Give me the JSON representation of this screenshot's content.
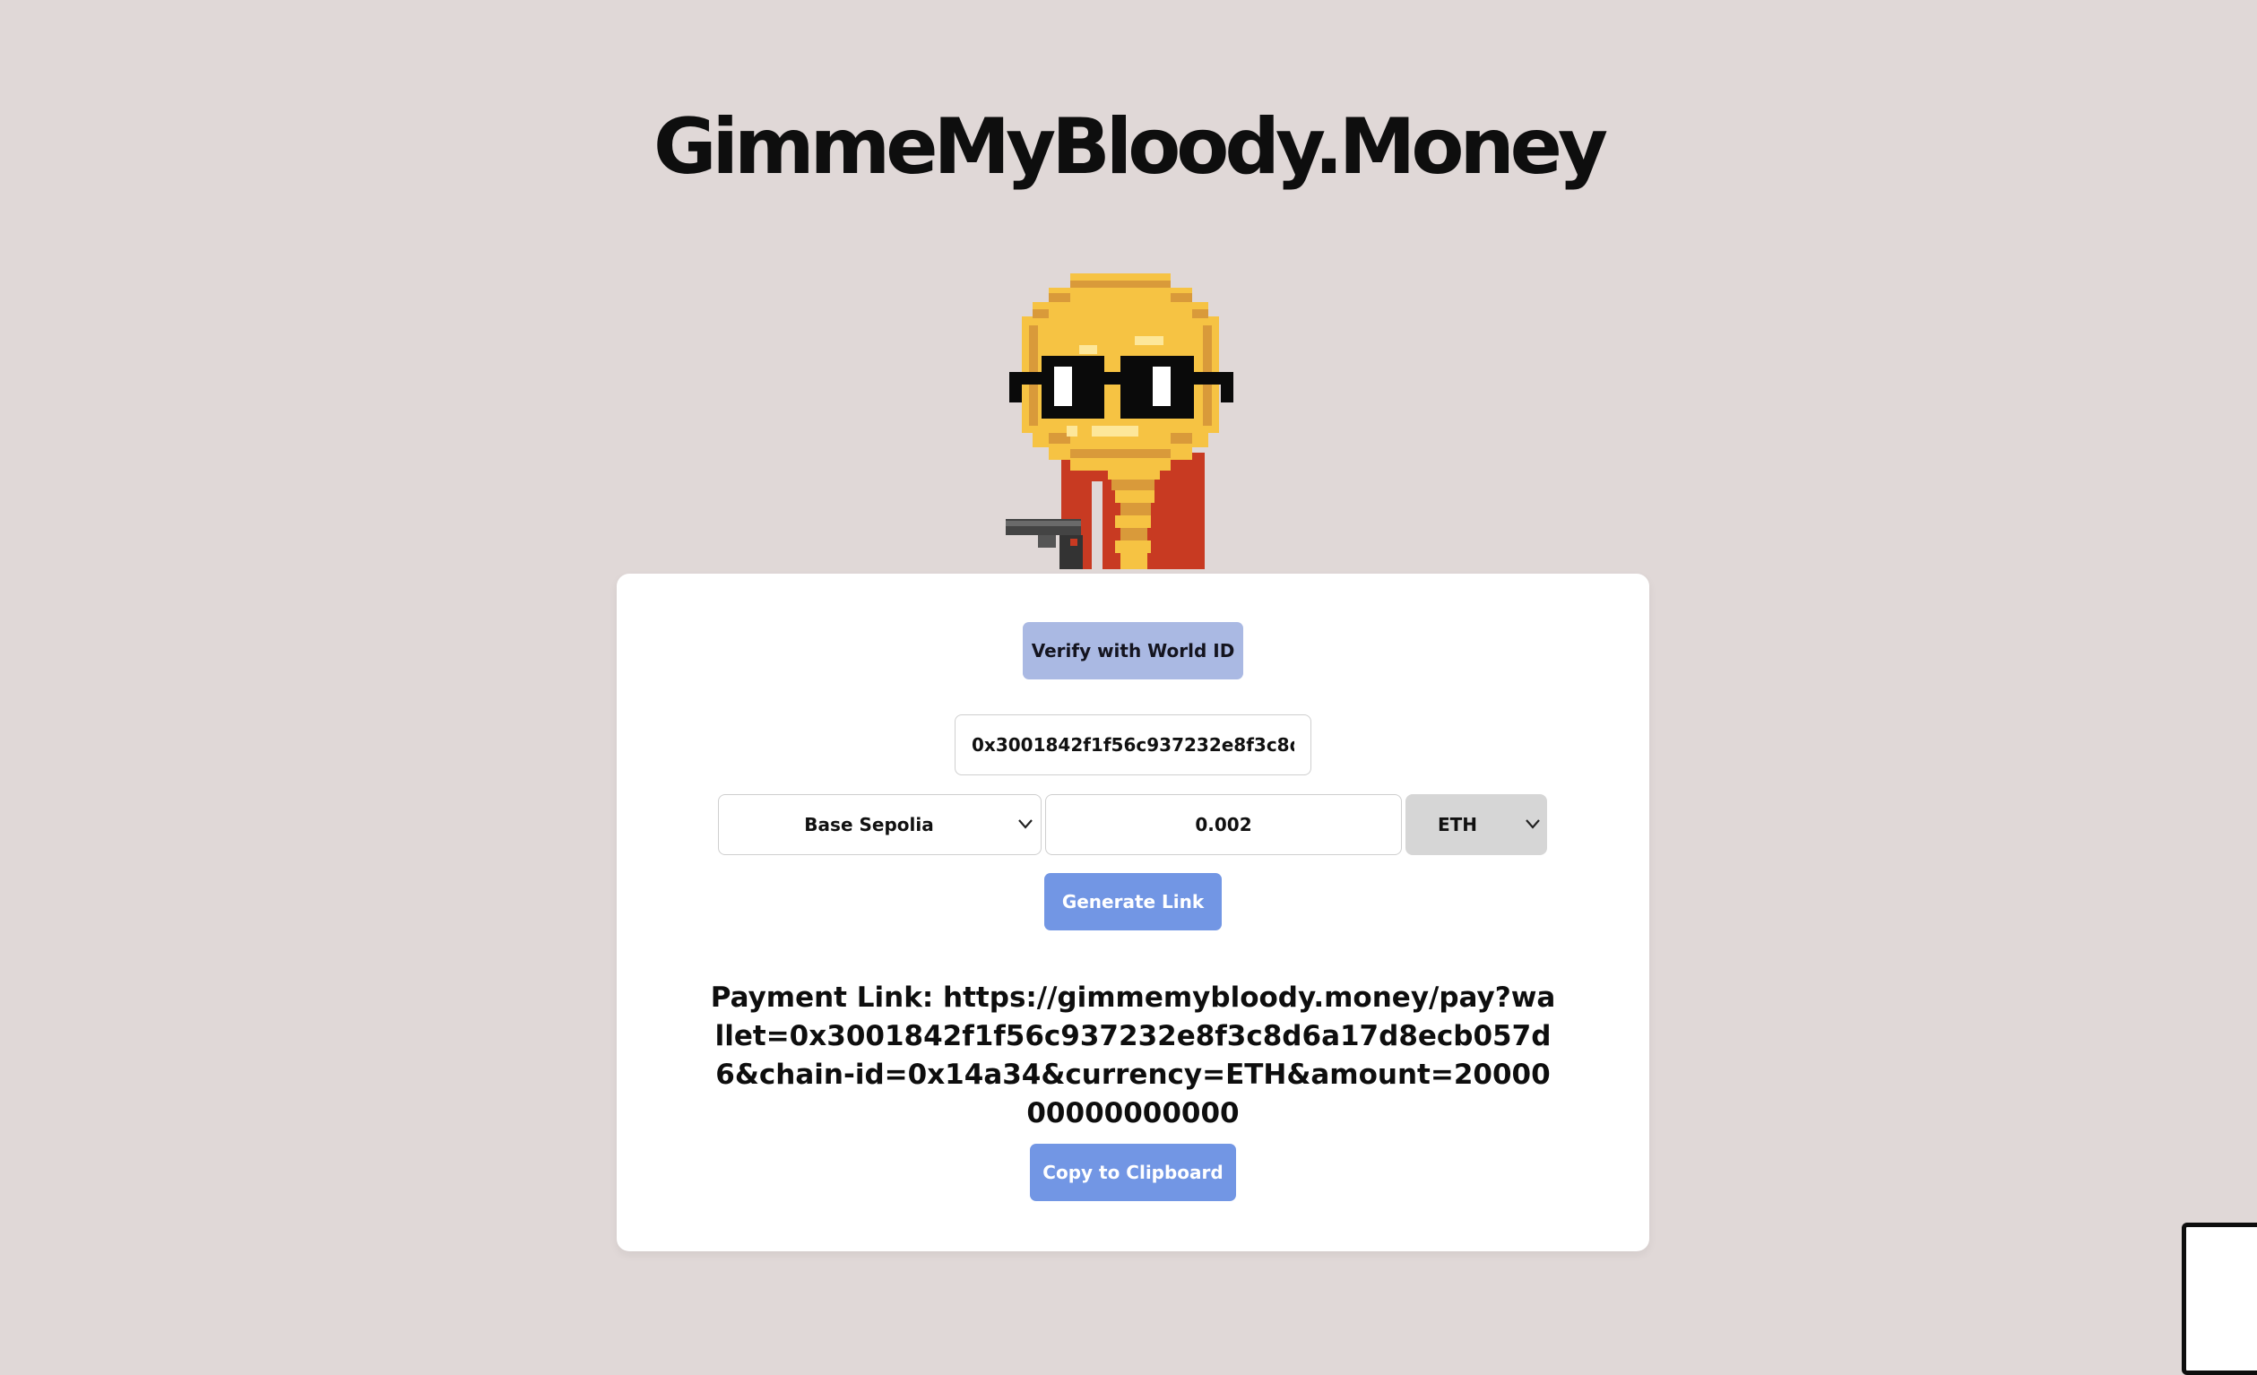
{
  "header": {
    "title": "GimmeMyBloody.Money"
  },
  "form": {
    "verify_label": "Verify with World ID",
    "wallet_value": "0x3001842f1f56c937232e8f3c8d6a17d8ecb057d6",
    "network_selected": "Base Sepolia",
    "amount_value": "0.002",
    "currency_selected": "ETH",
    "generate_label": "Generate Link"
  },
  "result": {
    "payment_link_text": "Payment Link: https://gimmemybloody.money/pay?wallet=0x3001842f1f56c937232e8f3c8d6a17d8ecb057d6&chain-id=0x14a34&currency=ETH&amount=2000000000000000",
    "copy_label": "Copy to Clipboard"
  },
  "icons": {
    "network_chevron": "chevron-down-icon",
    "currency_chevron": "chevron-down-icon",
    "mascot": "pixel-coin-mascot-with-sunglasses-and-pistol"
  },
  "colors": {
    "page_background": "#e0d8d7",
    "card_background": "#ffffff",
    "verify_button": "#aab9e3",
    "primary_button": "#7296e4",
    "currency_select_bg": "#d6d6d6",
    "coin_gold": "#f6c343",
    "coin_dark": "#d99a3a",
    "shirt_red": "#c83a22"
  }
}
